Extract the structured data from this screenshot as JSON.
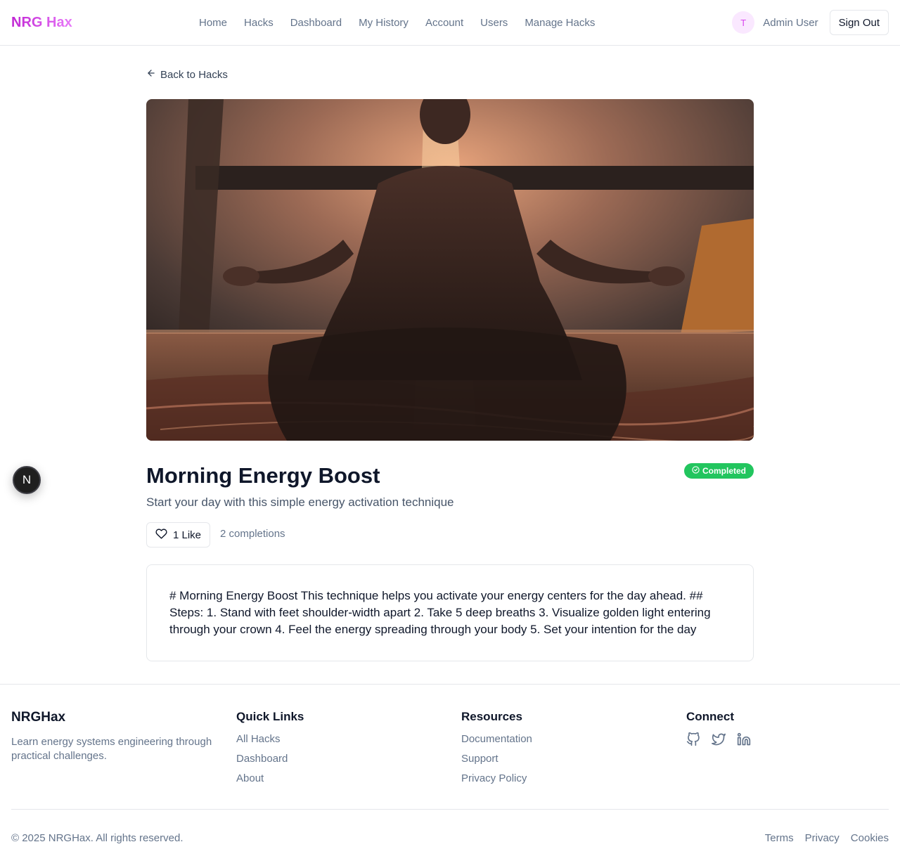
{
  "header": {
    "logo": "NRG Hax",
    "nav": [
      "Home",
      "Hacks",
      "Dashboard",
      "My History",
      "Account",
      "Users",
      "Manage Hacks"
    ],
    "avatar_initial": "T",
    "user_name": "Admin User",
    "sign_out_label": "Sign Out"
  },
  "page": {
    "back_label": "Back to Hacks",
    "hero_image": "meditation-silhouette-photo",
    "title": "Morning Energy Boost",
    "status_badge": "Completed",
    "subtitle": "Start your day with this simple energy activation technique",
    "like_label": "1 Like",
    "completions": "2 completions",
    "content": "# Morning Energy Boost This technique helps you activate your energy centers for the day ahead. ## Steps: 1. Stand with feet shoulder-width apart 2. Take 5 deep breaths 3. Visualize golden light entering through your crown 4. Feel the energy spreading through your body 5. Set your intention for the day"
  },
  "fab": {
    "label": "N"
  },
  "footer": {
    "brand": "NRGHax",
    "description": "Learn energy systems engineering through practical challenges.",
    "quick_links": {
      "heading": "Quick Links",
      "items": [
        "All Hacks",
        "Dashboard",
        "About"
      ]
    },
    "resources": {
      "heading": "Resources",
      "items": [
        "Documentation",
        "Support",
        "Privacy Policy"
      ]
    },
    "connect": {
      "heading": "Connect",
      "icons": [
        "github-icon",
        "twitter-icon",
        "linkedin-icon"
      ]
    },
    "copyright": "© 2025 NRGHax. All rights reserved.",
    "legal": [
      "Terms",
      "Privacy",
      "Cookies"
    ]
  },
  "colors": {
    "brand": "#d946ef",
    "success": "#22c55e",
    "muted": "#64748b"
  }
}
